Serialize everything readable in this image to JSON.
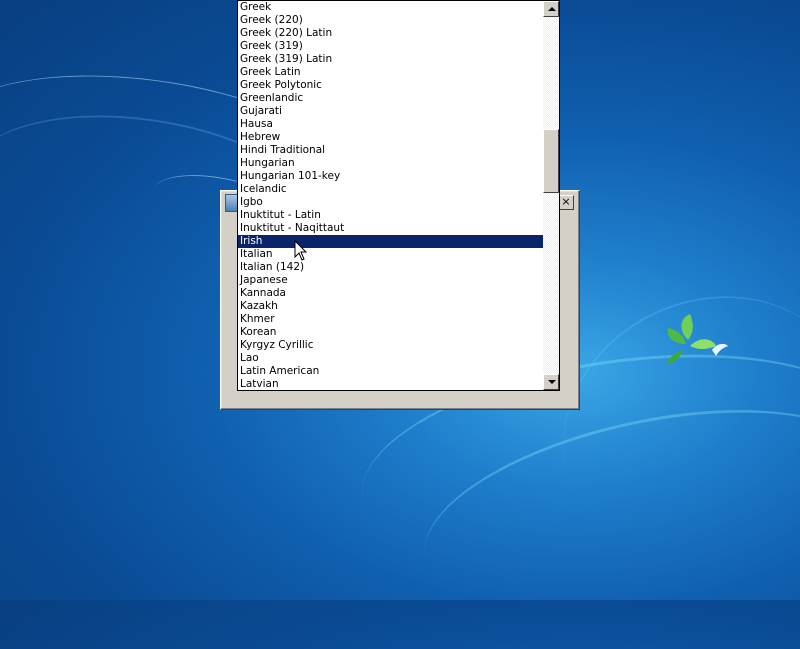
{
  "dialog": {
    "close_glyph": "×"
  },
  "language_list": {
    "items": [
      "Greek",
      "Greek (220)",
      "Greek (220) Latin",
      "Greek (319)",
      "Greek (319) Latin",
      "Greek Latin",
      "Greek Polytonic",
      "Greenlandic",
      "Gujarati",
      "Hausa",
      "Hebrew",
      "Hindi Traditional",
      "Hungarian",
      "Hungarian 101-key",
      "Icelandic",
      "Igbo",
      "Inuktitut - Latin",
      "Inuktitut - Naqittaut",
      "Irish",
      "Italian",
      "Italian (142)",
      "Japanese",
      "Kannada",
      "Kazakh",
      "Khmer",
      "Korean",
      "Kyrgyz Cyrillic",
      "Lao",
      "Latin American",
      "Latvian"
    ],
    "selected": "Irish"
  },
  "colors": {
    "selection_bg": "#0a246a",
    "selection_fg": "#ffffff",
    "desktop_blue": "#1060b0"
  },
  "icons": {
    "dialog_app": "window-app-icon",
    "close": "close-icon",
    "scroll_up": "arrow-up-icon",
    "scroll_down": "arrow-down-icon",
    "cursor": "mouse-pointer-icon",
    "wallpaper_logo": "windows-leaf-logo"
  }
}
